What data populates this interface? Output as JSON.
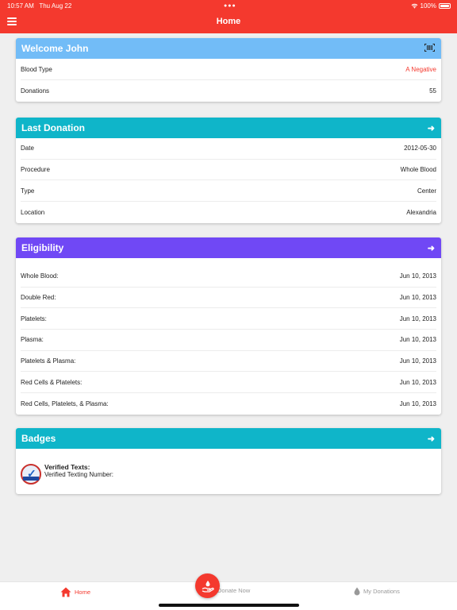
{
  "status": {
    "time": "10:57 AM",
    "date": "Thu Aug 22",
    "battery": "100%"
  },
  "nav": {
    "title": "Home",
    "menu_icon": "hamburger-icon"
  },
  "welcome": {
    "title": "Welcome John",
    "header_color": "#72bcf7",
    "header_icon": "barcode-icon",
    "rows": [
      {
        "label": "Blood Type",
        "value": "A Negative"
      },
      {
        "label": "Donations",
        "value": "55"
      }
    ]
  },
  "last_donation": {
    "title": "Last Donation",
    "header_color": "#0fb5c9",
    "rows": [
      {
        "label": "Date",
        "value": "2012-05-30"
      },
      {
        "label": "Procedure",
        "value": "Whole Blood"
      },
      {
        "label": "Type",
        "value": "Center"
      },
      {
        "label": "Location",
        "value": "Alexandria"
      }
    ]
  },
  "eligibility": {
    "title": "Eligibility",
    "header_color": "#7048f5",
    "rows": [
      {
        "label": "Whole Blood:",
        "value": "Jun 10, 2013"
      },
      {
        "label": "Double Red:",
        "value": "Jun 10, 2013"
      },
      {
        "label": "Platelets:",
        "value": "Jun 10, 2013"
      },
      {
        "label": "Plasma:",
        "value": "Jun 10, 2013"
      },
      {
        "label": "Platelets & Plasma:",
        "value": "Jun 10, 2013"
      },
      {
        "label": "Red Cells & Platelets:",
        "value": "Jun 10, 2013"
      },
      {
        "label": "Red Cells, Platelets, & Plasma:",
        "value": "Jun 10, 2013"
      }
    ]
  },
  "badges": {
    "title": "Badges",
    "header_color": "#0fb5c9",
    "item": {
      "title": "Verified Texts:",
      "subtitle": "Verified Texting Number:",
      "icon": "verified-badge-icon"
    }
  },
  "tabs": {
    "home": "Home",
    "donate": "Donate Now",
    "my_donations": "My Donations",
    "accent": "#f4392e"
  }
}
